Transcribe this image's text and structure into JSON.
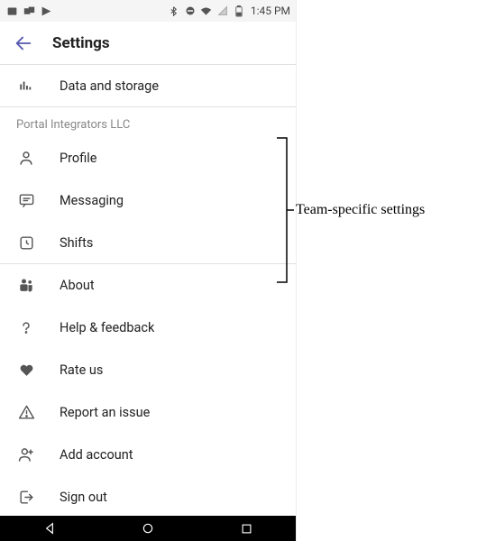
{
  "status": {
    "time": "1:45 PM"
  },
  "header": {
    "title": "Settings"
  },
  "top_item": {
    "label": "Data and storage"
  },
  "section": {
    "title": "Portal Integrators LLC",
    "items": [
      {
        "label": "Profile"
      },
      {
        "label": "Messaging"
      },
      {
        "label": "Shifts"
      }
    ]
  },
  "bottom_items": [
    {
      "label": "About"
    },
    {
      "label": "Help & feedback"
    },
    {
      "label": "Rate us"
    },
    {
      "label": "Report an issue"
    },
    {
      "label": "Add account"
    },
    {
      "label": "Sign out"
    }
  ],
  "callout": {
    "label": "Team-specific settings"
  }
}
